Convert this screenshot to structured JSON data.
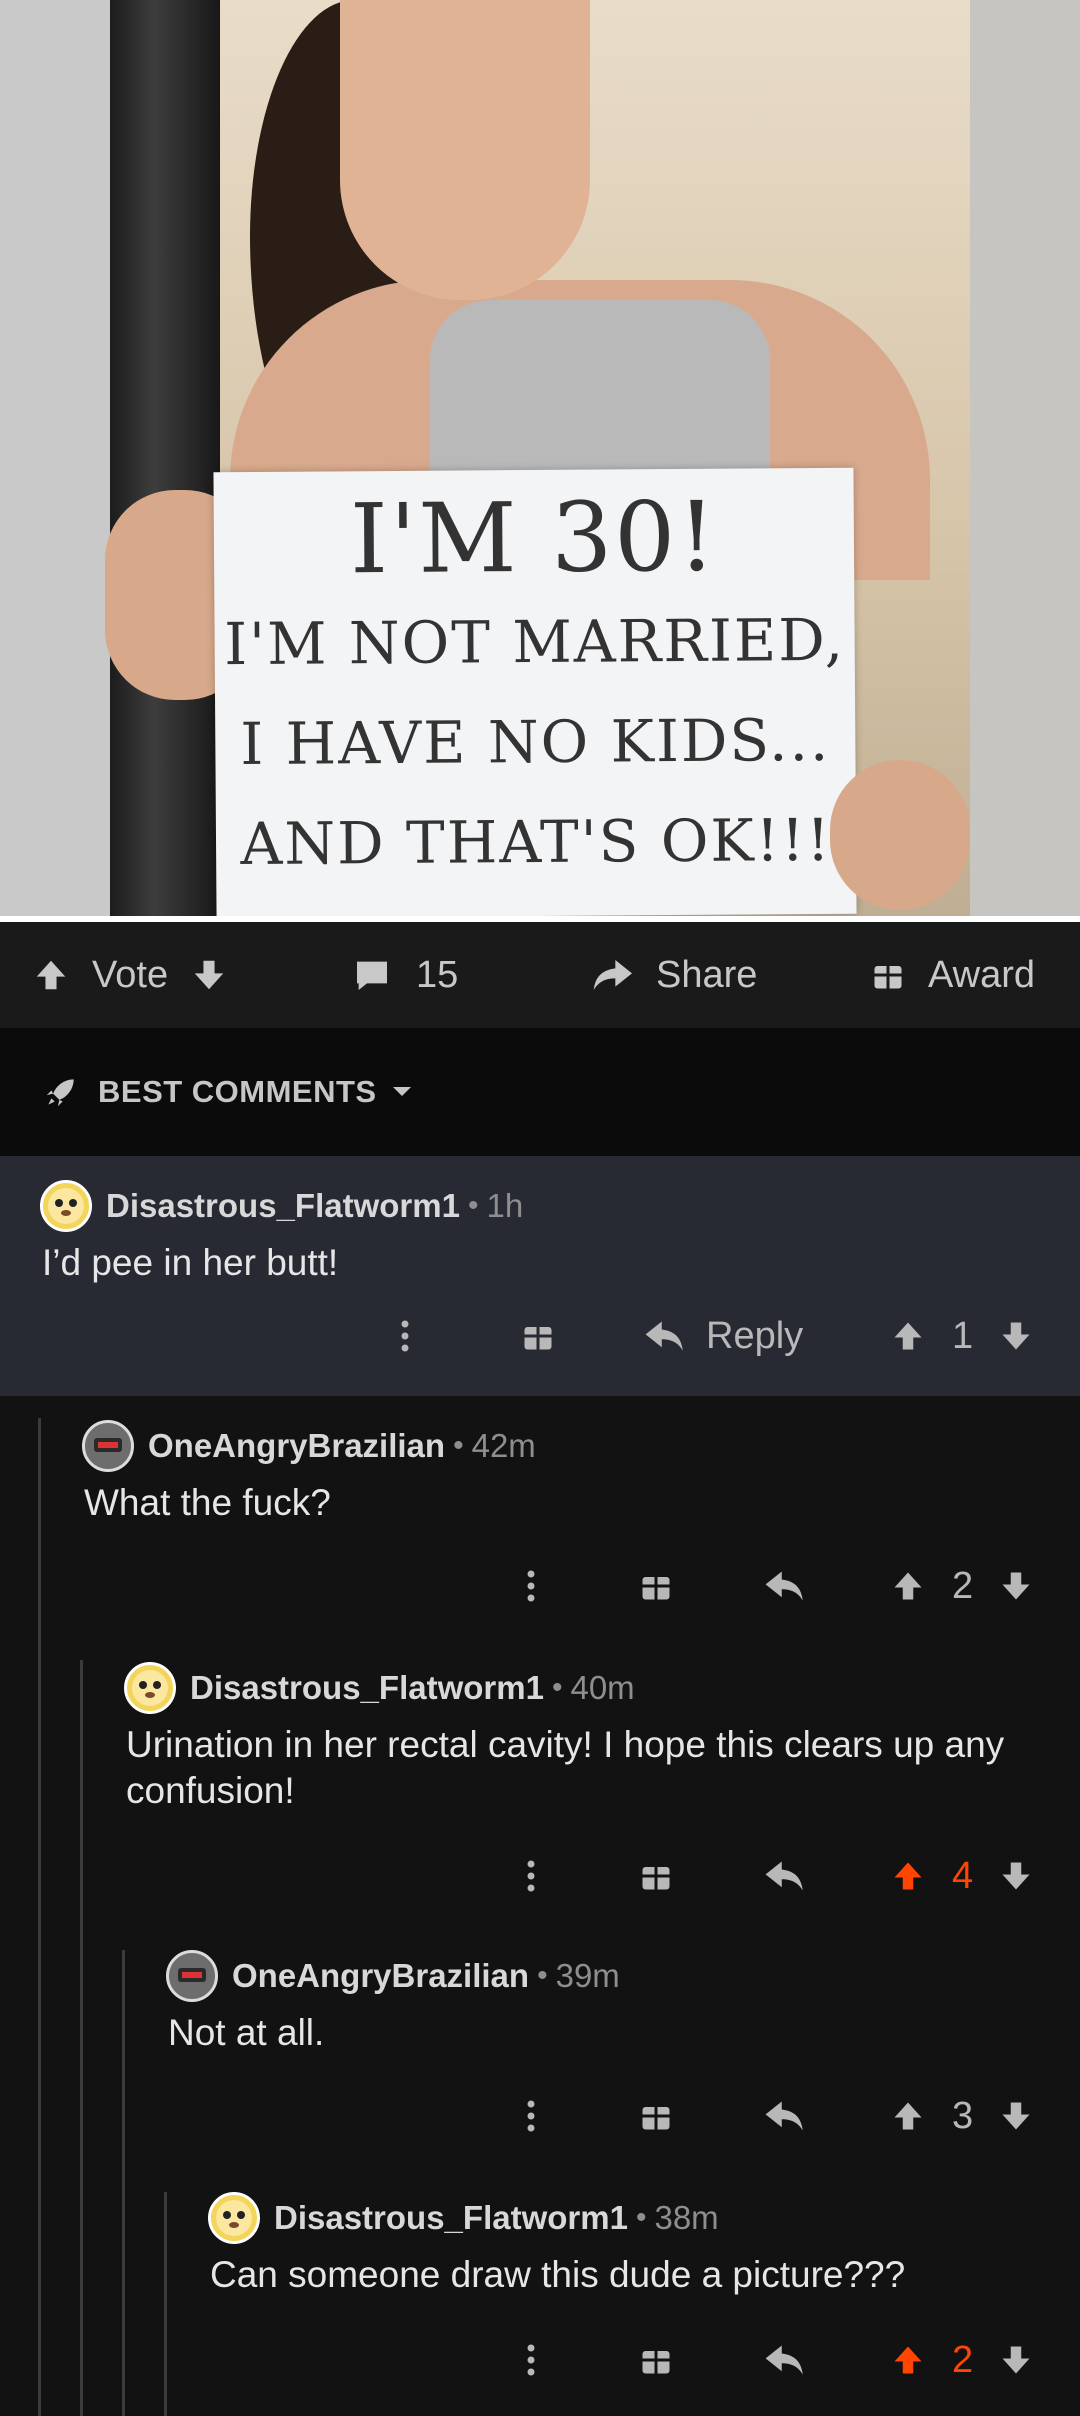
{
  "post": {
    "image_sign": {
      "line1": "I'M 30!",
      "line2": "I'M NOT MARRIED,",
      "line3": "I HAVE NO KIDS...",
      "line4": "AND THAT'S OK!!!"
    },
    "actions": {
      "vote_label": "Vote",
      "comment_count": "15",
      "share_label": "Share",
      "award_label": "Award"
    }
  },
  "sort": {
    "label": "BEST COMMENTS"
  },
  "comments": [
    {
      "user": "Disastrous_Flatworm1",
      "time": "1h",
      "body": "I’d pee in her butt!",
      "reply_label": "Reply",
      "score": "1",
      "score_highlight": false,
      "avatar": "yellow-dog-avatar"
    },
    {
      "user": "OneAngryBrazilian",
      "time": "42m",
      "body": "What the fuck?",
      "score": "2",
      "score_highlight": false,
      "avatar": "robot-avatar"
    },
    {
      "user": "Disastrous_Flatworm1",
      "time": "40m",
      "body": "Urination in her rectal cavity! I hope this clears up any confusion!",
      "score": "4",
      "score_highlight": true,
      "avatar": "yellow-dog-avatar"
    },
    {
      "user": "OneAngryBrazilian",
      "time": "39m",
      "body": "Not at all.",
      "score": "3",
      "score_highlight": false,
      "avatar": "robot-avatar"
    },
    {
      "user": "Disastrous_Flatworm1",
      "time": "38m",
      "body": "Can someone draw this dude a picture???",
      "score": "2",
      "score_highlight": true,
      "avatar": "yellow-dog-avatar"
    }
  ],
  "colors": {
    "background": "#121212",
    "highlight_comment_bg": "#272a33",
    "upvote_orange": "#ff4500",
    "text_muted": "#8e8e8e"
  }
}
